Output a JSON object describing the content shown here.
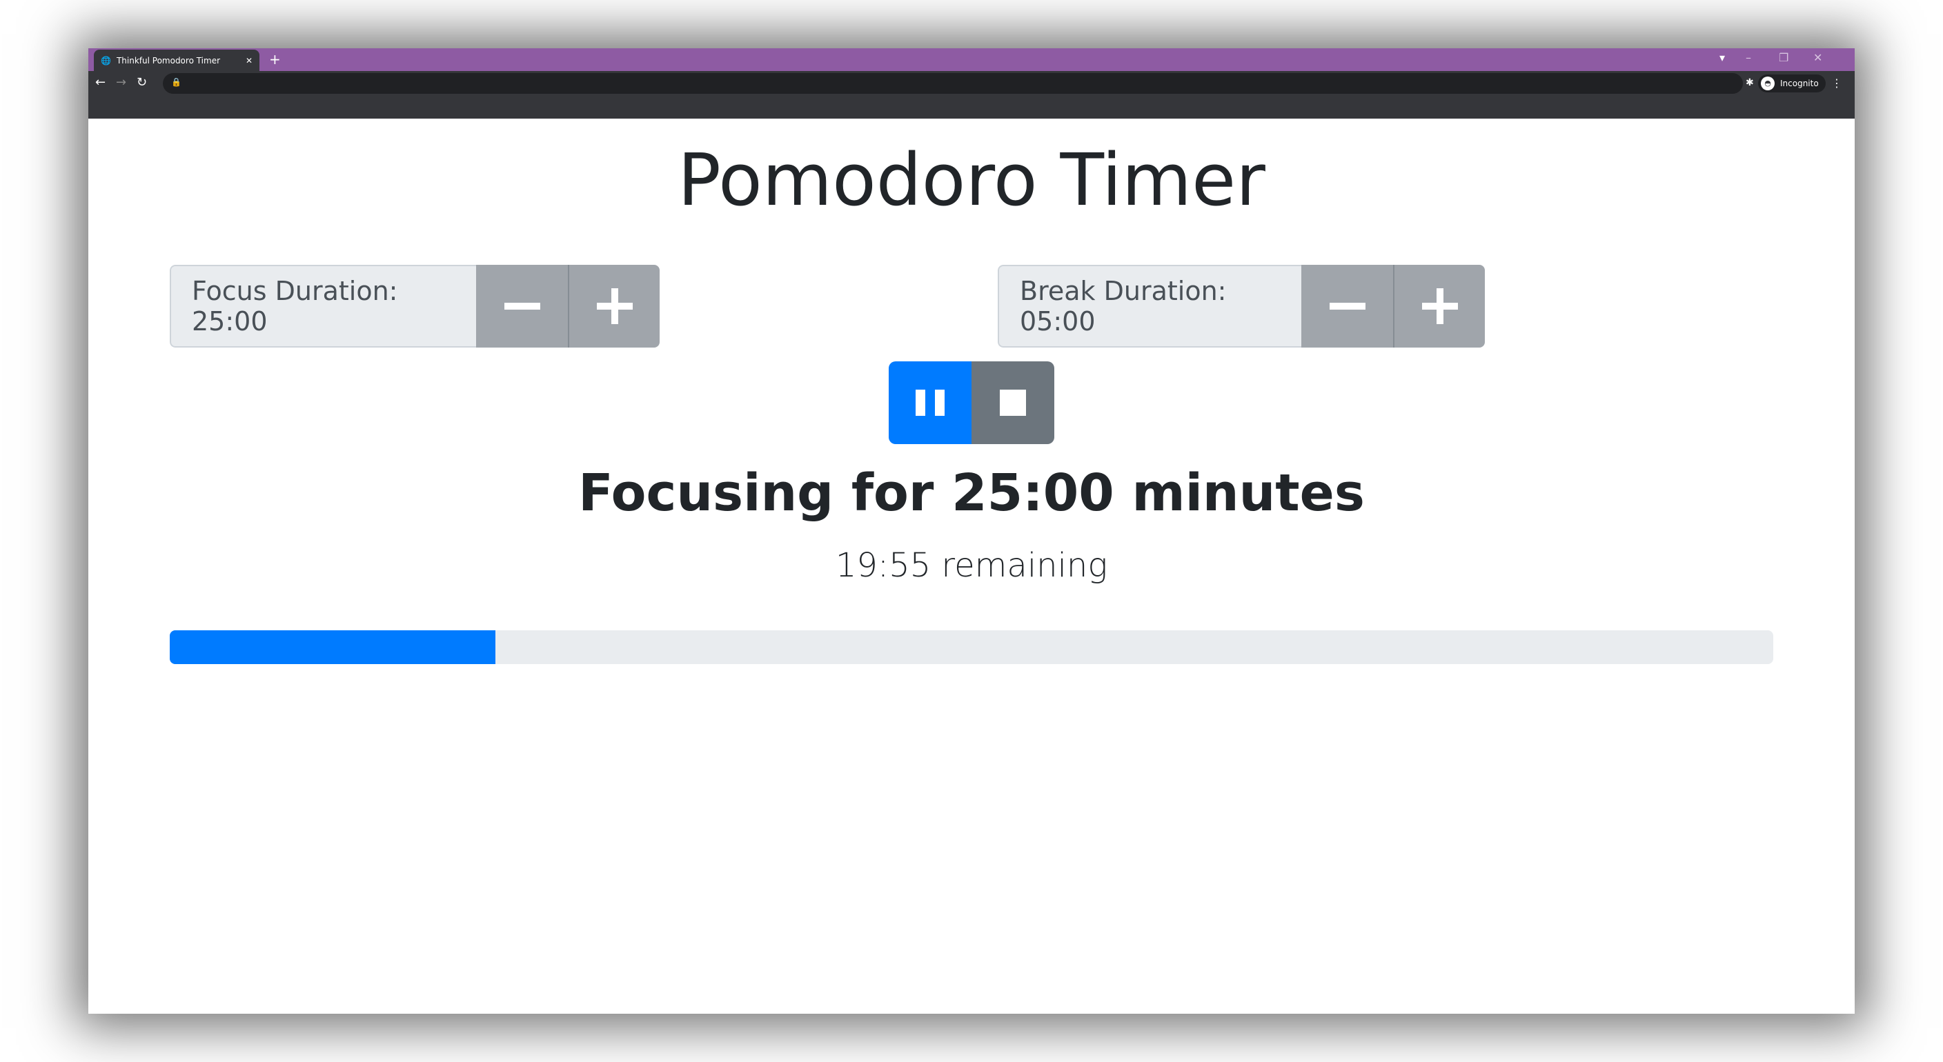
{
  "browser": {
    "tab_title": "Thinkful Pomodoro Timer",
    "incognito_label": "Incognito"
  },
  "app": {
    "title": "Pomodoro Timer",
    "focus": {
      "label": "Focus Duration: 25:00"
    },
    "break": {
      "label": "Break Duration: 05:00"
    },
    "session_heading": "Focusing for 25:00 minutes",
    "remaining": "19:55 remaining",
    "progress_percent": 20.33,
    "colors": {
      "primary": "#007bff",
      "secondary": "#6c757d"
    }
  }
}
